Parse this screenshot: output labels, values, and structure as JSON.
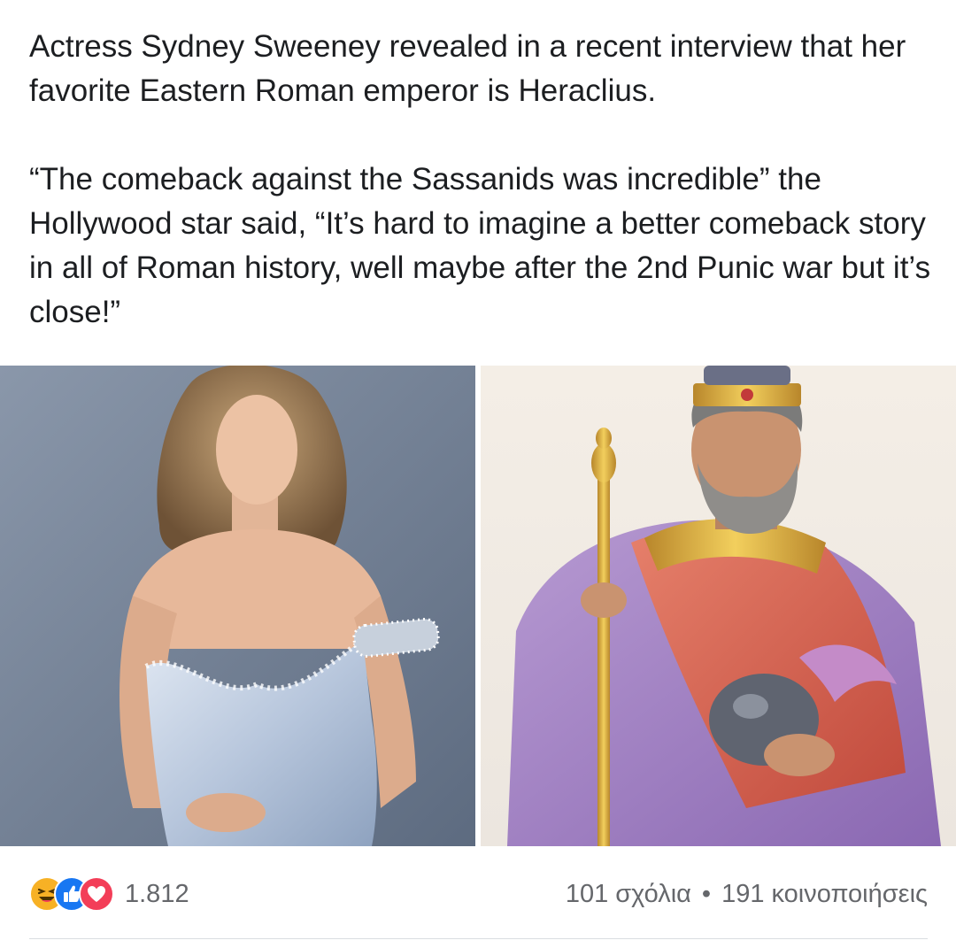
{
  "post": {
    "paragraph1": "Actress Sydney Sweeney revealed in a recent interview that her favorite Eastern Roman emperor is Heraclius.",
    "paragraph2": "“The comeback against the Sassanids was incredible” the Hollywood star said, “It’s hard to imagine a better comeback story in all of Roman history, well maybe after the 2nd Punic war but it’s close!”"
  },
  "images": {
    "left_icon": "photo-woman-blue-dress",
    "right_icon": "painting-emperor-heraclius"
  },
  "footer": {
    "reaction_icons": [
      "haha-icon",
      "like-icon",
      "love-icon"
    ],
    "reaction_count": "1.812",
    "comments": "101 σχόλια",
    "separator": "•",
    "shares": "191 κοινοποιήσεις"
  },
  "colors": {
    "text": "#1c1e21",
    "secondary": "#65676b",
    "like_blue": "#1877f2",
    "love_red": "#f33e58",
    "haha_yellow": "#f7b125"
  }
}
